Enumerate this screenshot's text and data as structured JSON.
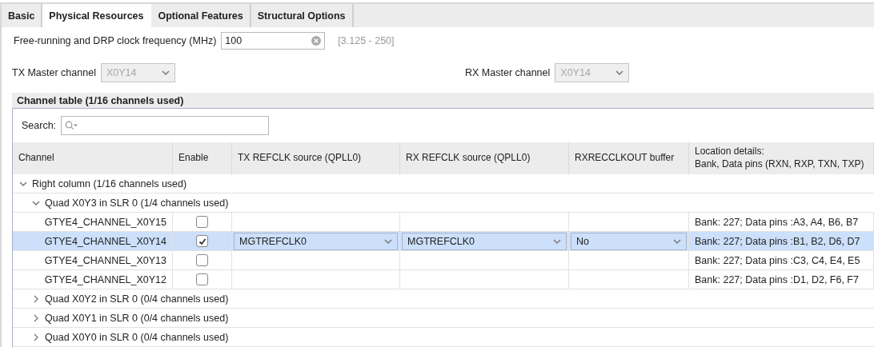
{
  "tabs": [
    {
      "label": "Basic",
      "selected": false
    },
    {
      "label": "Physical Resources",
      "selected": true
    },
    {
      "label": "Optional Features",
      "selected": false
    },
    {
      "label": "Structural Options",
      "selected": false
    }
  ],
  "frequency": {
    "label": "Free-running and DRP clock frequency (MHz)",
    "value": "100",
    "range": "[3.125 - 250]"
  },
  "tx_master": {
    "label": "TX Master channel",
    "value": "X0Y14",
    "disabled": true
  },
  "rx_master": {
    "label": "RX Master channel",
    "value": "X0Y14",
    "disabled": true
  },
  "channel_table": {
    "title": "Channel table (1/16 channels used)",
    "search_label": "Search:",
    "columns": [
      "Channel",
      "Enable",
      "TX REFCLK source (QPLL0)",
      "RX REFCLK source (QPLL0)",
      "RXRECCLKOUT buffer",
      "Location details:\nBank, Data pins (RXN, RXP, TXN, TXP)"
    ],
    "rows": [
      {
        "label": "Right column (1/16 channels used)",
        "expanded": true,
        "children": [
          {
            "label": "Quad X0Y3 in SLR 0 (1/4 channels used)",
            "expanded": true,
            "children": [
              {
                "name": "GTYE4_CHANNEL_X0Y15",
                "enabled": false,
                "selected": false,
                "location": "Bank: 227; Data pins :A3, A4, B6, B7"
              },
              {
                "name": "GTYE4_CHANNEL_X0Y14",
                "enabled": true,
                "selected": true,
                "tx_refclk": "MGTREFCLK0",
                "rx_refclk": "MGTREFCLK0",
                "rxrecclkout": "No",
                "location": "Bank: 227; Data pins :B1, B2, D6, D7"
              },
              {
                "name": "GTYE4_CHANNEL_X0Y13",
                "enabled": false,
                "selected": false,
                "location": "Bank: 227; Data pins :C3, C4, E4, E5"
              },
              {
                "name": "GTYE4_CHANNEL_X0Y12",
                "enabled": false,
                "selected": false,
                "location": "Bank: 227; Data pins :D1, D2, F6, F7"
              }
            ]
          },
          {
            "label": "Quad X0Y2 in SLR 0 (0/4 channels used)",
            "expanded": false
          },
          {
            "label": "Quad X0Y1 in SLR 0 (0/4 channels used)",
            "expanded": false
          },
          {
            "label": "Quad X0Y0 in SLR 0 (0/4 channels used)",
            "expanded": false
          }
        ]
      }
    ]
  }
}
